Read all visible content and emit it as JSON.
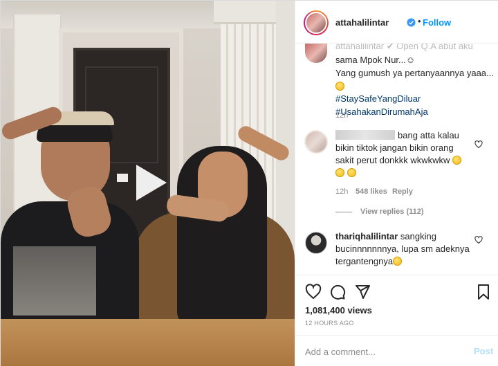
{
  "header": {
    "username": "attahalilintar",
    "follow_label": "Follow",
    "separator": "•",
    "more_label": "•••"
  },
  "caption": {
    "truncated_line": "attahalilintar ✔ Open Q.A   abut aku",
    "line1": "sama Mpok Nur...☺",
    "line2": "Yang gumush ya pertanyaannya yaaa...",
    "hashtag1": "#StaySafeYangDiluar",
    "hashtag2": "#UsahakanDirumahAja",
    "age": "12h"
  },
  "comments": [
    {
      "text_line1": "bang atta kalau",
      "text_line2": "bikin tiktok jangan bikin orang",
      "text_line3": "sakit perut donkkk wkwkwkw",
      "age": "12h",
      "likes": "548 likes",
      "reply_label": "Reply",
      "view_replies": "View replies (112)"
    },
    {
      "username": "thariqhalilintar",
      "text_line1": "sangking",
      "text_line2": "bucinnnnnnnya, lupa sm adeknya",
      "text_line3": "tergantengnya"
    }
  ],
  "stats": {
    "views": "1,081,400 views",
    "time": "12 HOURS AGO"
  },
  "add_comment": {
    "placeholder": "Add a comment...",
    "post_label": "Post"
  },
  "colors": {
    "accent": "#0095f6",
    "hashtag": "#00376b",
    "muted": "#8e8e8e",
    "post_disabled": "#b2dffc"
  },
  "icons": [
    "play-icon",
    "verified-icon",
    "heart-icon",
    "comment-icon",
    "share-icon",
    "bookmark-icon",
    "more-icon"
  ]
}
